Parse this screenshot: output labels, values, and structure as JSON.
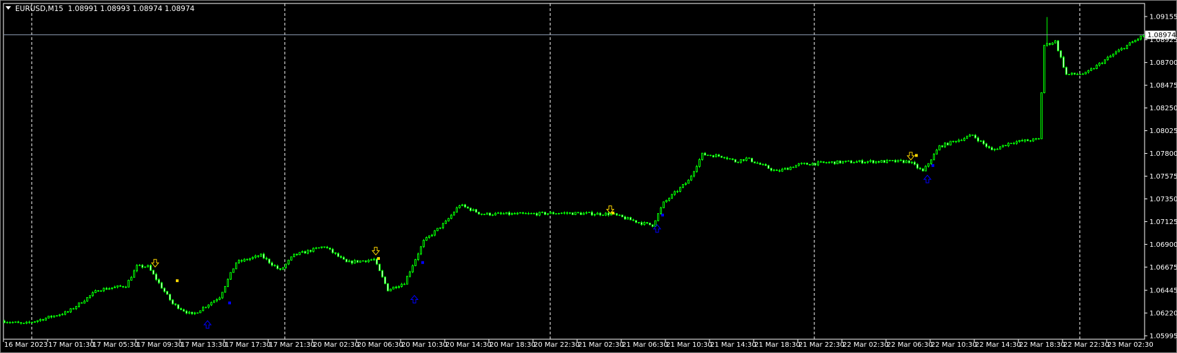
{
  "header": {
    "symbol_timeframe": "EURUSD,M15",
    "ohlc": "1.08991 1.08993 1.08974 1.08974"
  },
  "colors": {
    "background": "#000000",
    "bull_outline": "#00ff00",
    "bull_body": "#000000",
    "bear_body": "#ffffff",
    "grid": "#ffffff",
    "bid_line": "#8c9ab0",
    "sell_arrow": "#ffd700",
    "buy_arrow": "#0000ff"
  },
  "chart_data": {
    "type": "candlestick",
    "symbol": "EURUSD",
    "timeframe": "M15",
    "current_price": "1.08974",
    "ylim": [
      1.05995,
      1.09155
    ],
    "y_ticks": [
      "1.09155",
      "1.08925",
      "1.08700",
      "1.08475",
      "1.08250",
      "1.08025",
      "1.07800",
      "1.07575",
      "1.07350",
      "1.07125",
      "1.06900",
      "1.06675",
      "1.06445",
      "1.06220",
      "1.05995"
    ],
    "x_ticks": [
      "16 Mar 2023",
      "17 Mar 01:30",
      "17 Mar 05:30",
      "17 Mar 09:30",
      "17 Mar 13:30",
      "17 Mar 17:30",
      "17 Mar 21:30",
      "20 Mar 02:30",
      "20 Mar 06:30",
      "20 Mar 10:30",
      "20 Mar 14:30",
      "20 Mar 18:30",
      "20 Mar 22:30",
      "21 Mar 02:30",
      "21 Mar 06:30",
      "21 Mar 10:30",
      "21 Mar 14:30",
      "21 Mar 18:30",
      "21 Mar 22:30",
      "22 Mar 02:30",
      "22 Mar 06:30",
      "22 Mar 10:30",
      "22 Mar 14:30",
      "22 Mar 18:30",
      "22 Mar 22:30",
      "23 Mar 02:30"
    ],
    "close_path": [
      [
        "16 Mar 21:30",
        1.0614
      ],
      [
        "16 Mar 23:15",
        1.0611
      ],
      [
        "17 Mar 03:15",
        1.0623
      ],
      [
        "17 Mar 06:00",
        1.0645
      ],
      [
        "17 Mar 08:30",
        1.0649
      ],
      [
        "17 Mar 09:30",
        1.0668
      ],
      [
        "17 Mar 10:30",
        1.0668
      ],
      [
        "17 Mar 12:45",
        1.0631
      ],
      [
        "17 Mar 14:30",
        1.062
      ],
      [
        "17 Mar 17:00",
        1.0638
      ],
      [
        "17 Mar 18:30",
        1.0672
      ],
      [
        "17 Mar 20:45",
        1.0679
      ],
      [
        "17 Mar 22:45",
        1.0664
      ],
      [
        "20 Mar 00:15",
        1.0679
      ],
      [
        "20 Mar 03:30",
        1.0688
      ],
      [
        "20 Mar 05:30",
        1.0672
      ],
      [
        "20 Mar 08:00",
        1.0675
      ],
      [
        "20 Mar 09:15",
        1.0645
      ],
      [
        "20 Mar 10:45",
        1.0652
      ],
      [
        "20 Mar 12:30",
        1.0693
      ],
      [
        "20 Mar 14:30",
        1.0712
      ],
      [
        "20 Mar 15:45",
        1.0729
      ],
      [
        "20 Mar 17:45",
        1.072
      ],
      [
        "20 Mar 22:00",
        1.072
      ],
      [
        "21 Mar 00:45",
        1.0721
      ],
      [
        "21 Mar 05:30",
        1.072
      ],
      [
        "21 Mar 08:15",
        1.0711
      ],
      [
        "21 Mar 09:15",
        1.0709
      ],
      [
        "21 Mar 10:15",
        1.0731
      ],
      [
        "21 Mar 12:30",
        1.0753
      ],
      [
        "21 Mar 13:45",
        1.0779
      ],
      [
        "21 Mar 15:45",
        1.0777
      ],
      [
        "21 Mar 16:45",
        1.0772
      ],
      [
        "21 Mar 17:45",
        1.0775
      ],
      [
        "21 Mar 20:30",
        1.0762
      ],
      [
        "21 Mar 22:30",
        1.0769
      ],
      [
        "22 Mar 01:15",
        1.0771
      ],
      [
        "22 Mar 04:45",
        1.0772
      ],
      [
        "22 Mar 08:30",
        1.0772
      ],
      [
        "22 Mar 09:45",
        1.0762
      ],
      [
        "22 Mar 11:15",
        1.0787
      ],
      [
        "22 Mar 14:15",
        1.0798
      ],
      [
        "22 Mar 16:00",
        1.0783
      ],
      [
        "22 Mar 17:45",
        1.0791
      ],
      [
        "22 Mar 20:15",
        1.0794
      ],
      [
        "22 Mar 20:45",
        1.0887
      ],
      [
        "22 Mar 21:45",
        1.0891
      ],
      [
        "22 Mar 22:45",
        1.0858
      ],
      [
        "23 Mar 00:30",
        1.0859
      ],
      [
        "23 Mar 03:15",
        1.088
      ],
      [
        "23 Mar 05:45",
        1.0897
      ]
    ],
    "spike_high": [
      "22 Mar 21:00",
      1.0915
    ],
    "signals": {
      "sell_arrows": [
        [
          "17 Mar 11:15",
          1.0671
        ],
        [
          "20 Mar 08:15",
          1.0683
        ],
        [
          "21 Mar 05:30",
          1.0724
        ],
        [
          "22 Mar 08:45",
          1.0777
        ]
      ],
      "sell_marks": [
        [
          "17 Mar 13:15",
          1.0654
        ],
        [
          "20 Mar 08:30",
          1.0676
        ],
        [
          "21 Mar 05:45",
          1.0721
        ],
        [
          "22 Mar 09:15",
          1.0778
        ]
      ],
      "buy_arrows": [
        [
          "17 Mar 16:00",
          1.0611
        ],
        [
          "20 Mar 11:45",
          1.0636
        ],
        [
          "21 Mar 09:45",
          1.0706
        ],
        [
          "22 Mar 10:15",
          1.0755
        ]
      ],
      "buy_marks": [
        [
          "17 Mar 18:00",
          1.0632
        ],
        [
          "20 Mar 12:30",
          1.0672
        ],
        [
          "21 Mar 10:15",
          1.0719
        ],
        [
          "22 Mar 10:45",
          1.0768
        ]
      ]
    }
  }
}
